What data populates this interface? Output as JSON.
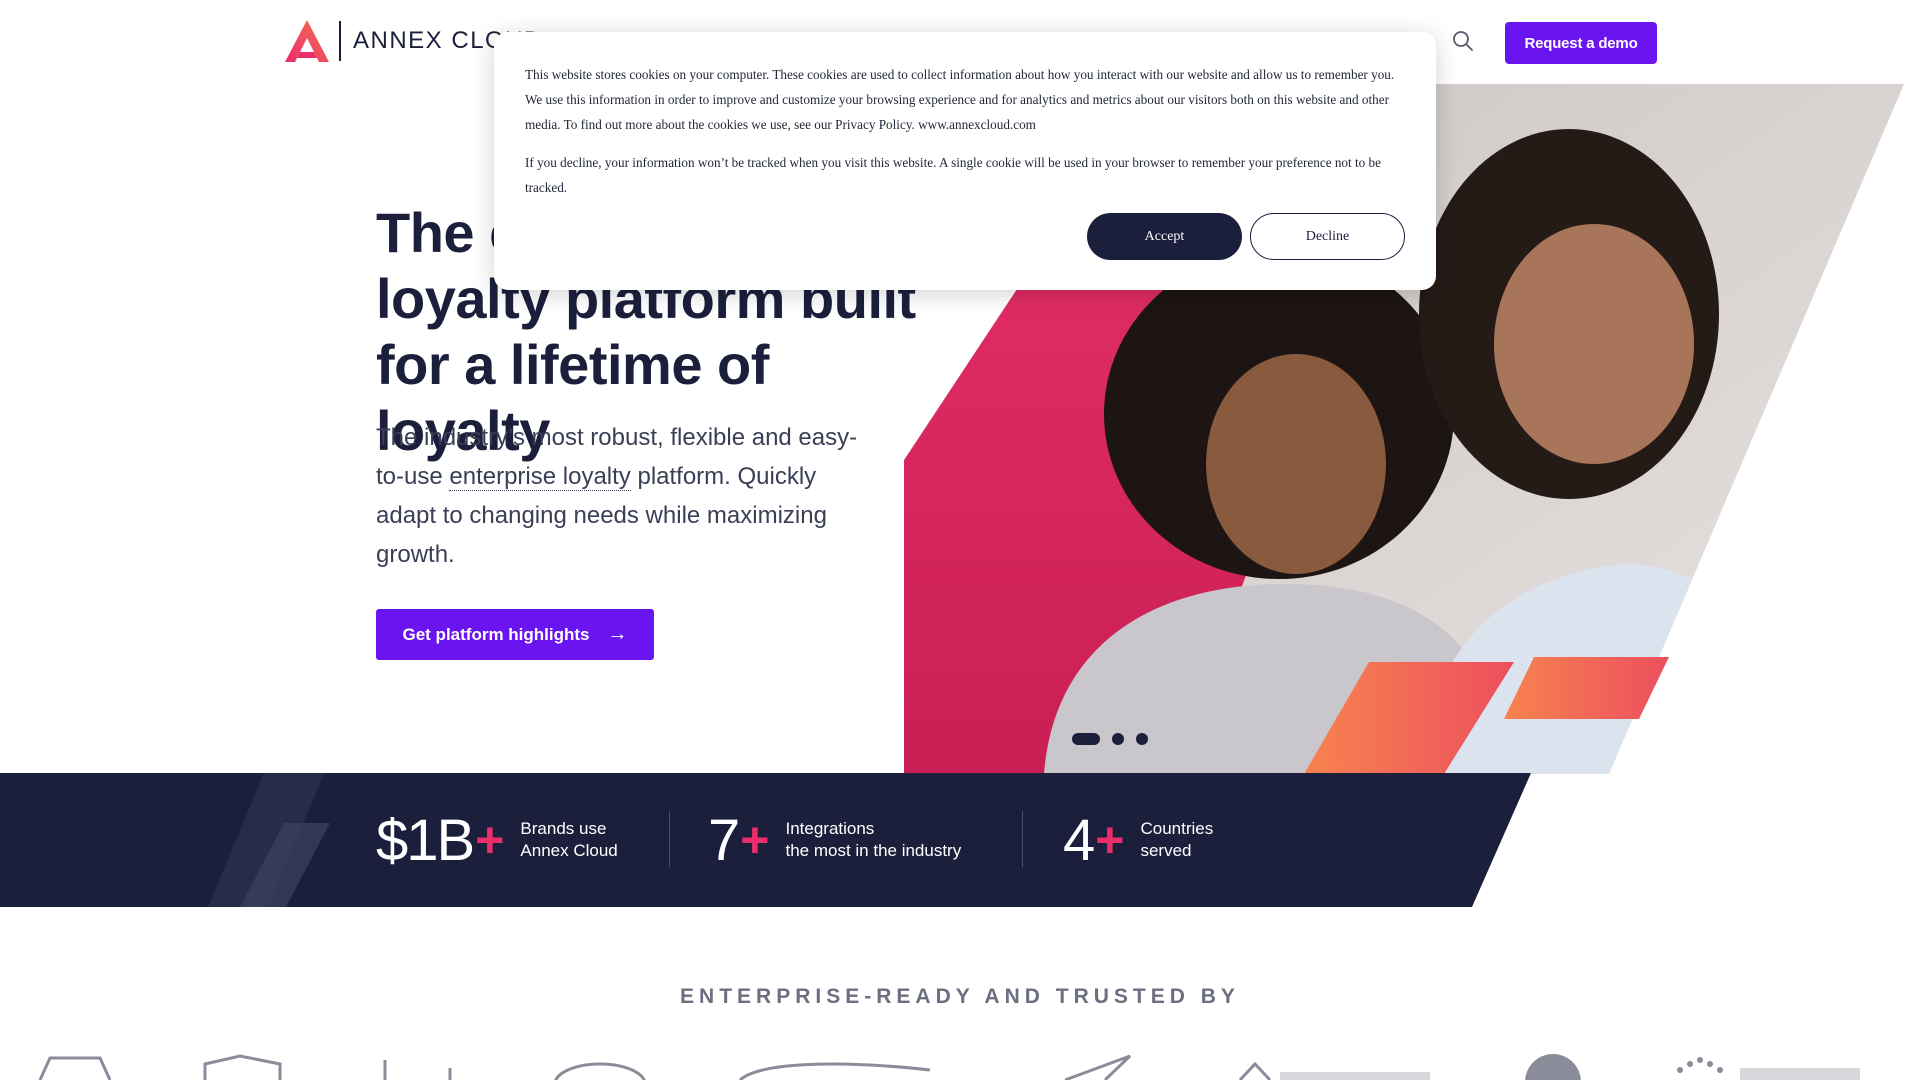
{
  "header": {
    "brand_text": "ANNEX CLOUD",
    "demo_label": "Request a demo",
    "icons": [
      "annex-cloud-logo",
      "search-icon"
    ]
  },
  "hero": {
    "title": "The enterprise loyalty platform built for a lifetime of loyalty",
    "subtitle_pre": "The industry’s most robust, flexible and easy-to-use ",
    "subtitle_link": "enterprise loyalty",
    "subtitle_post": " platform. Quickly adapt to changing needs while maximizing growth.",
    "cta_label": "Get platform highlights",
    "cta_arrow": "→",
    "slides": 3,
    "active_slide": 1
  },
  "stats": {
    "items": [
      {
        "number": "$1B",
        "plus": "+",
        "line1": "Brands use",
        "line2": "Annex Cloud"
      },
      {
        "number": "7",
        "plus": "+",
        "line1": "Integrations",
        "line2": "the most in the industry"
      },
      {
        "number": "4",
        "plus": "+",
        "line1": "Countries",
        "line2": "served"
      }
    ]
  },
  "trusted": {
    "heading": "ENTERPRISE-READY AND TRUSTED BY"
  },
  "cookie": {
    "p1": "This website stores cookies on your computer. These cookies are used to collect information about how you interact with our website and allow us to remember you. We use this information in order to improve and customize your browsing experience and for analytics and metrics about our visitors both on this website and other media. To find out more about the cookies we use, see our Privacy Policy.  www.annexcloud.com",
    "p2": "If you decline, your information won’t be tracked when you visit this website. A single cookie will be used in your browser to remember your preference not to be tracked.",
    "accept_label": "Accept",
    "decline_label": "Decline"
  },
  "colors": {
    "navy": "#1c1f3c",
    "purple": "#6a14f0",
    "pink": "#ec2d6c",
    "orange": "#f4714f"
  }
}
